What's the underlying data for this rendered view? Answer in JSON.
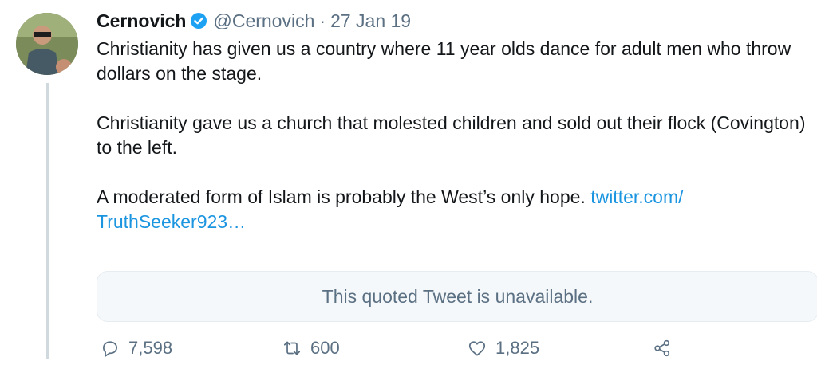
{
  "tweet": {
    "author_name": "Cernovich",
    "handle": "@Cernovich",
    "separator": "·",
    "date": "27 Jan 19",
    "paragraph1": "Christianity has given us a country where 11 year olds dance for adult men who throw dollars on the stage.",
    "paragraph2": "Christianity gave us a church that molested children and sold out their flock (Covington) to the left.",
    "paragraph3_text": "A moderated form of Islam is probably the West’s only hope.",
    "link_line1": "twitter.com/",
    "link_line2": "TruthSeeker923…",
    "quoted_unavailable": "This quoted Tweet is unavailable."
  },
  "actions": {
    "reply_count": "7,598",
    "retweet_count": "600",
    "like_count": "1,825"
  },
  "colors": {
    "link": "#1b95e0",
    "verified_badge": "#1da1f2",
    "secondary_text": "#5b7083"
  },
  "icons": [
    "verified-badge-icon",
    "reply-icon",
    "retweet-icon",
    "like-icon",
    "share-icon"
  ]
}
